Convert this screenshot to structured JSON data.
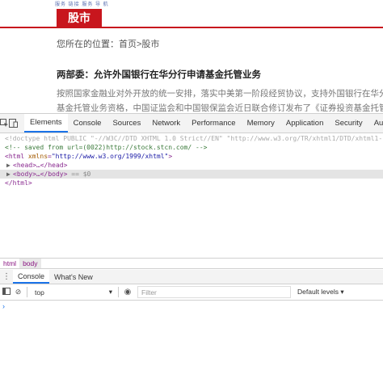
{
  "page": {
    "top_links": "服务 链接 服务 导 航",
    "section_tab": "股市",
    "breadcrumb": "您所在的位置：首页>股市",
    "article_title": "两部委：允许外国银行在华分行申请基金托管业务",
    "article_line1": "按照国家金融业对外开放的统一安排，落实中美第一阶段经贸协议，支持外国银行在华分行申请",
    "article_line2": "基金托管业务资格，中国证监会和中国银保监会近日联合修订发布了《证券投资基金托管业务"
  },
  "devtools": {
    "tabs": [
      "Elements",
      "Console",
      "Sources",
      "Network",
      "Performance",
      "Memory",
      "Application",
      "Security",
      "Audits"
    ],
    "active_tab": "Elements",
    "code": {
      "doctype": "<!doctype html PUBLIC \"-//W3C//DTD XHTML 1.0 Strict//EN\" \"http://www.w3.org/TR/xhtml1/DTD/xhtml1-strict.dtd\">",
      "saved_comment": "<!-- saved from url=(0022)http://stock.stcn.com/ -->",
      "html_open_tag": "<html",
      "xmlns_attr": "xmlns",
      "xmlns_value": "\"http://www.w3.org/1999/xhtml\"",
      "html_open_end": ">",
      "head_line": "<head>…</head>",
      "body_line": "<body>…</body>",
      "body_suffix": " == $0",
      "html_close": "</html>"
    },
    "breadcrumbs": [
      "html",
      "body"
    ],
    "drawer_tabs": [
      "Console",
      "What's New"
    ],
    "console": {
      "context": "top",
      "filter_placeholder": "Filter",
      "levels": "Default levels ▾",
      "prompt": "›"
    }
  }
}
